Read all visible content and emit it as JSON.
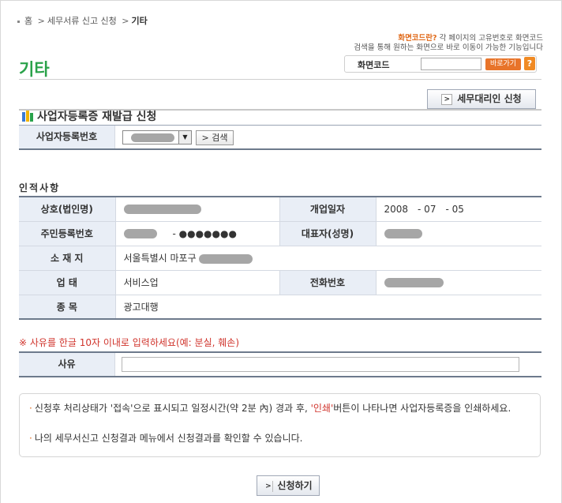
{
  "breadcrumb": {
    "home": "홈",
    "sep1": ">",
    "section": "세무서류 신고 신청",
    "sep2": ">",
    "current": "기타"
  },
  "help": {
    "link": "화면코드란?",
    "line1_rest": " 각 페이지의 고유번호로 화면코드",
    "line2": "검색을 통해 원하는 화면으로 바로 이동이 가능한 기능입니다"
  },
  "page": {
    "title": "기타"
  },
  "screen_code": {
    "label": "화면코드",
    "go_label": "바로가기",
    "help_glyph": "?"
  },
  "agent_button": {
    "arrow": ">",
    "label": "세무대리인 신청"
  },
  "section": {
    "title": "사업자등록증 재발급 신청"
  },
  "reg": {
    "label": "사업자등록번호",
    "dropdown_glyph": "▼",
    "search_label": "> 검색"
  },
  "info": {
    "title": "인적사항",
    "rows": [
      {
        "label1": "상호(법인명)",
        "label2": "개업일자",
        "value2": "2008　- 07　- 05"
      },
      {
        "label1": "주민등록번호",
        "mask": "- ●●●●●●●",
        "label2": "대표자(성명)"
      },
      {
        "label1": "소 재 지",
        "value1": "서울특별시 마포구"
      },
      {
        "label1": "업 태",
        "value1": "서비스업",
        "label2": "전화번호"
      },
      {
        "label1": "종 목",
        "value1": "광고대행"
      }
    ]
  },
  "reason": {
    "notice": "※ 사유를 한글 10자 이내로 입력하세요(예: 분실, 훼손)",
    "label": "사유",
    "value": ""
  },
  "notes": {
    "n1_a": "신청후 처리상태가 '접속'으로 표시되고 일정시간(약 2분 內) 경과 후, ",
    "n1_red": "'인쇄'",
    "n1_b": "버튼이 나타나면 사업자등록증을 인쇄하세요.",
    "n2": "나의 세무서신고 신청결과 메뉴에서 신청결과를 확인할 수 있습니다."
  },
  "apply_button": {
    "arrow": ">",
    "label": "신청하기"
  },
  "colors": {
    "title_green": "#2aa24a",
    "accent_orange": "#e8742a",
    "notice_red": "#d0342c",
    "th_bg": "#e9eef6"
  }
}
